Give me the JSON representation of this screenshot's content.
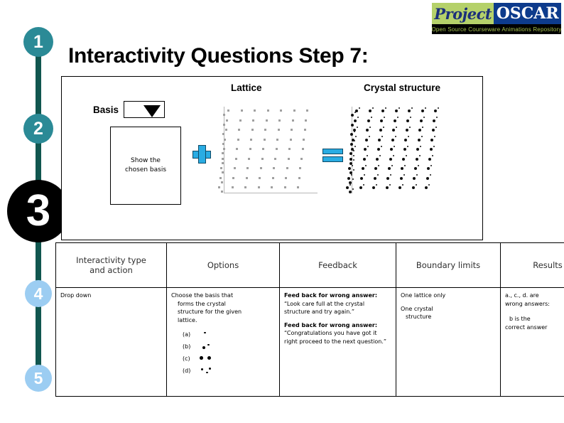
{
  "logo": {
    "word1": "Project",
    "word2": "OSCAR",
    "tagline": "Open Source Courseware Animations Repository"
  },
  "rail": {
    "step1": "1",
    "step2": "2",
    "step3": "3",
    "step4": "4",
    "step5": "5"
  },
  "title": "Interactivity Questions Step 7:",
  "illustration": {
    "lattice_label": "Lattice",
    "crystal_label": "Crystal structure",
    "basis_label": "Basis",
    "basis_select_value": "",
    "basis_box_line1": "Show the",
    "basis_box_line2": "chosen basis",
    "plus_icon": "plus-icon",
    "equals_icon": "equals-icon",
    "caret_icon": "chevron-down-icon"
  },
  "table": {
    "headers": [
      "Interactivity type and action",
      "Options",
      "Feedback",
      "Boundary limits",
      "Results"
    ],
    "header1_line1": "Interactivity type",
    "header1_line2": "and action",
    "interactivity": "Drop down",
    "options": {
      "prompt_line1": "Choose the basis that",
      "prompt_line2": "forms the crystal",
      "prompt_line3": "structure for the given",
      "prompt_line4": "lattice.",
      "items": [
        {
          "key": "(a)",
          "art": "one-dot"
        },
        {
          "key": "(b)",
          "art": "dot-pair-diagonal"
        },
        {
          "key": "(c)",
          "art": "two-dots-horizontal"
        },
        {
          "key": "(d)",
          "art": "three-dots"
        }
      ]
    },
    "feedback": {
      "block1_lead": "Feed back for wrong answer:",
      "block1_text": " “Look care full at the crystal structure and try again.”",
      "block2_lead": "Feed back for wrong answer:",
      "block2_text": " “Congratulations you have got it right proceed to the next question.”"
    },
    "boundary": {
      "line1": "One lattice only",
      "line2": "One crystal",
      "line2b": "structure"
    },
    "results": {
      "line1": "a., c., d. are",
      "line1b": "wrong answers:",
      "line2": "b is the",
      "line2b": "correct answer"
    }
  },
  "colors": {
    "rail_line": "#11564f",
    "rail_circle_teal": "#2b8a96",
    "rail_circle_blue": "#9ccdf2",
    "rail_circle_black": "#000000",
    "accent_blue": "#29ace3",
    "logo_green": "#b5d16a",
    "logo_navy": "#0d3b8c"
  }
}
